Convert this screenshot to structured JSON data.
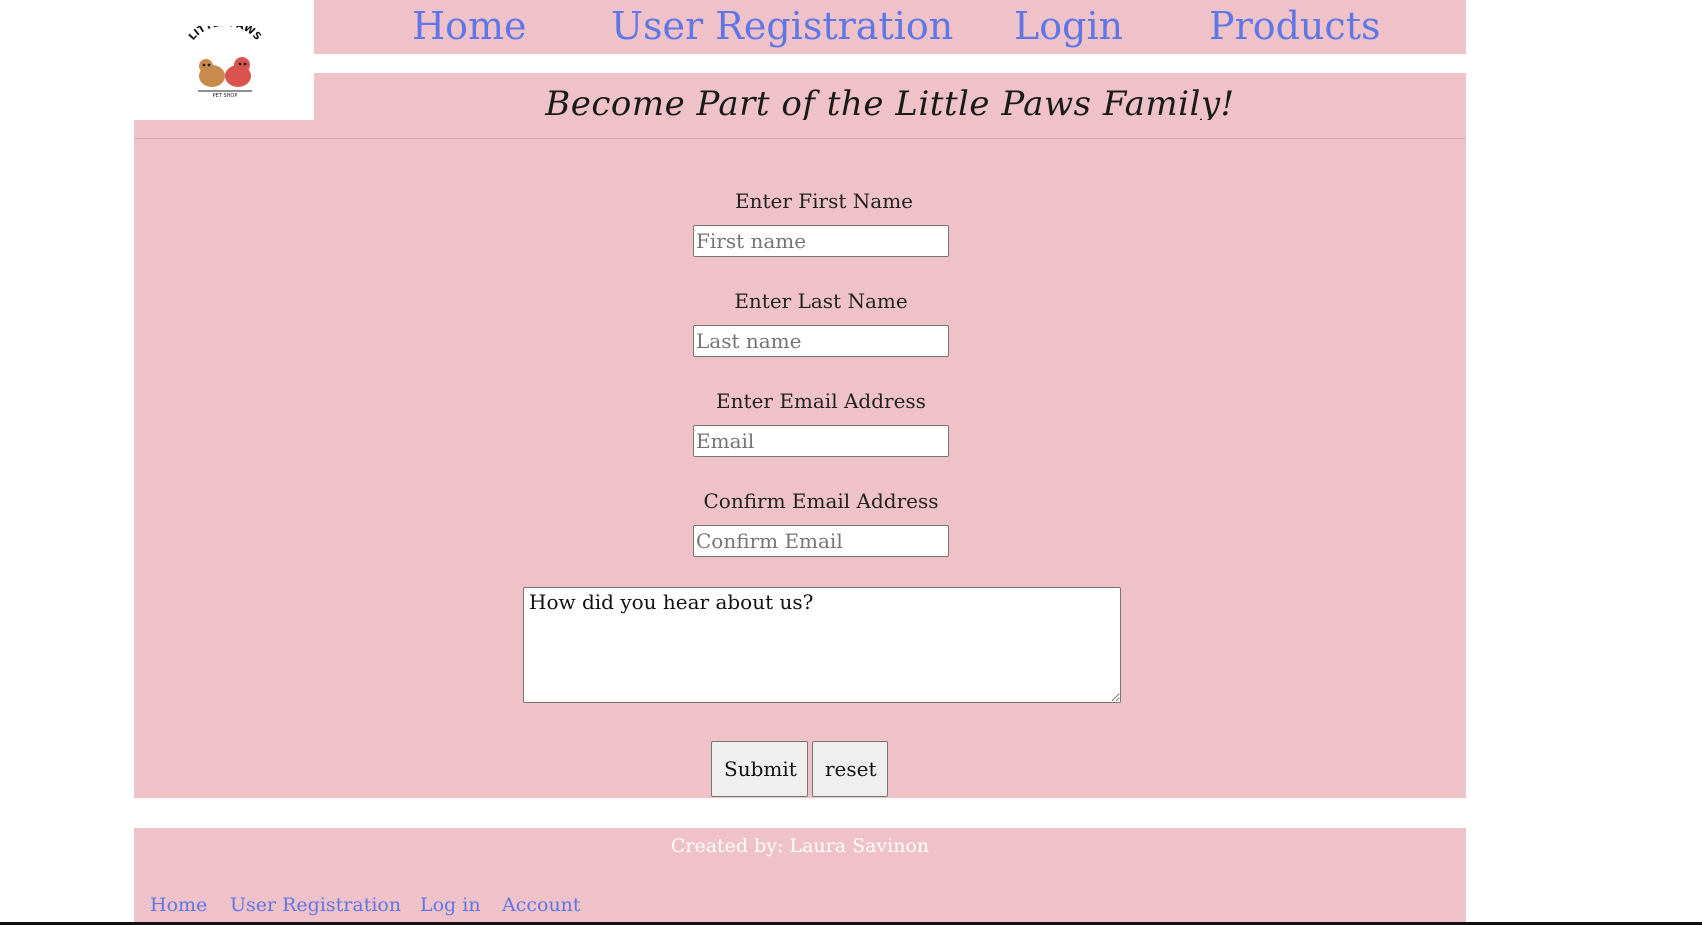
{
  "logo": {
    "text_top": "LITTLE PAWS",
    "text_bottom": "PET SHOP"
  },
  "nav": {
    "items": [
      {
        "label": "Home"
      },
      {
        "label": "User Registration"
      },
      {
        "label": "Login"
      },
      {
        "label": "Products"
      }
    ]
  },
  "tagline": "Become Part of the Little Paws Family!",
  "form": {
    "first_name": {
      "label": "Enter First Name",
      "placeholder": "First name",
      "value": ""
    },
    "last_name": {
      "label": "Enter Last Name",
      "placeholder": "Last name",
      "value": ""
    },
    "email": {
      "label": "Enter Email Address",
      "placeholder": "Email",
      "value": ""
    },
    "confirm_email": {
      "label": "Confirm Email Address",
      "placeholder": "Confirm Email",
      "value": ""
    },
    "comments": {
      "value": "How did you hear about us?"
    },
    "submit_label": "Submit",
    "reset_label": "reset"
  },
  "footer": {
    "credit": "Created by: Laura Savinon",
    "links": [
      {
        "label": "Home"
      },
      {
        "label": "User Registration"
      },
      {
        "label": "Log in"
      },
      {
        "label": "Account"
      }
    ]
  },
  "colors": {
    "panel_pink": "#efc1c9",
    "link_blue": "#5f76e6",
    "button_gray": "#efefef"
  }
}
